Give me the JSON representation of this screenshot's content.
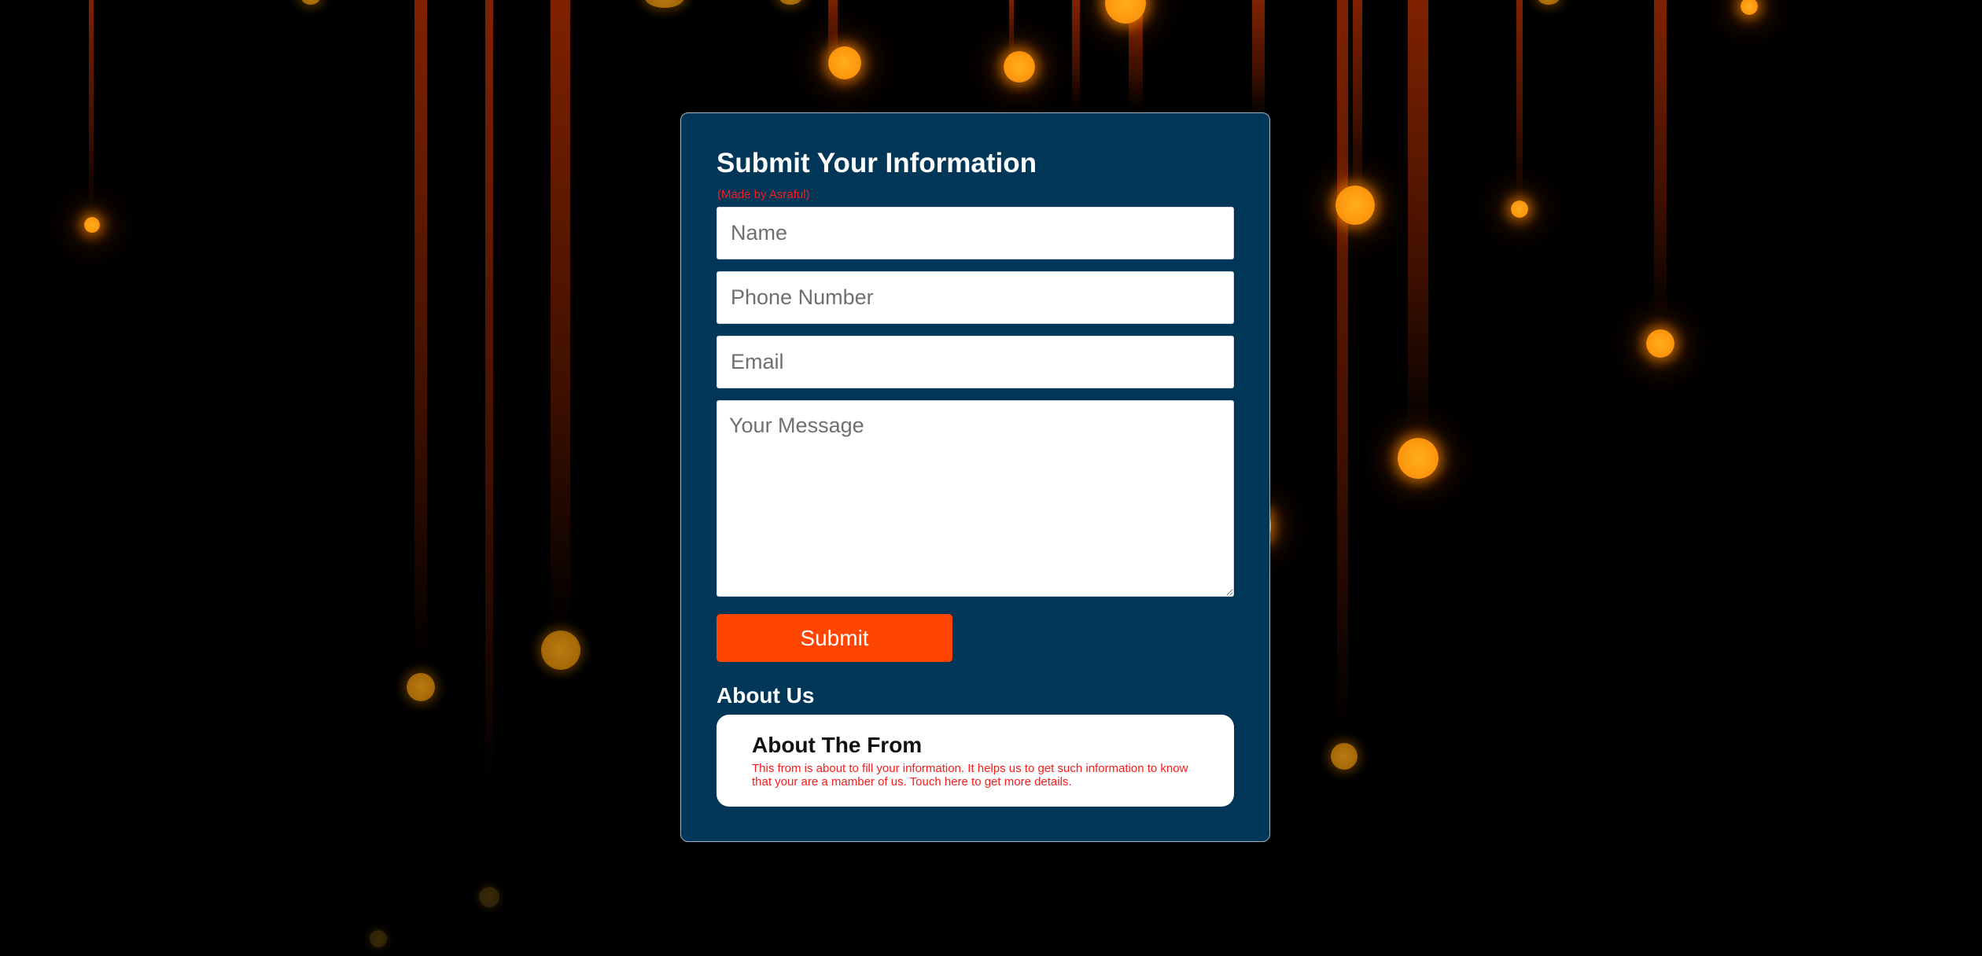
{
  "form": {
    "title": "Submit Your Information",
    "made_by": "(Made by Asraful)",
    "name_placeholder": "Name",
    "phone_placeholder": "Phone Number",
    "email_placeholder": "Email",
    "message_placeholder": "Your Message",
    "submit_label": "Submit"
  },
  "about": {
    "heading": "About Us",
    "card_title": "About The From",
    "card_text": "This from is about to fill your information. It helps us to get such information to know that your are a mamber of us. Touch here to get more details."
  },
  "colors": {
    "background": "#000000",
    "card_background": "#003658",
    "accent": "#ff4500",
    "made_by_text": "#ff1a1a",
    "orb": "#ffa014"
  }
}
